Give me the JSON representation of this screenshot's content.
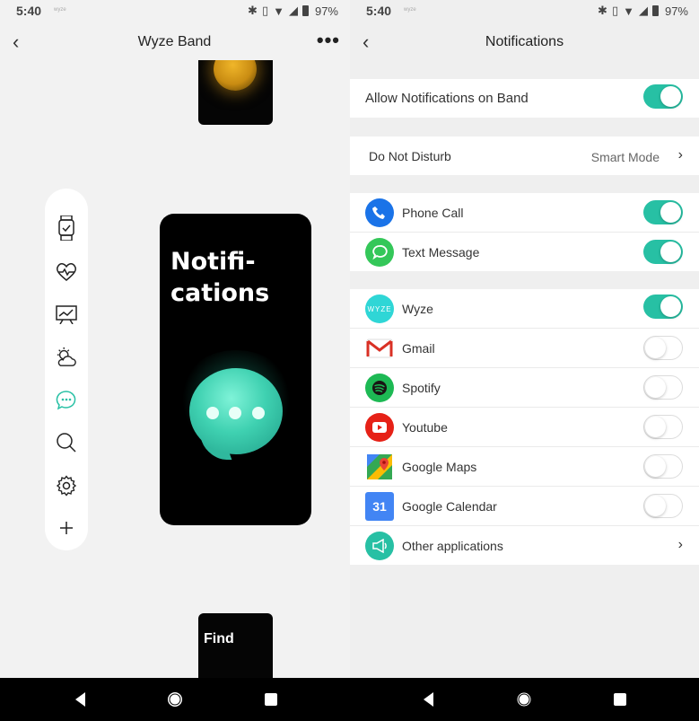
{
  "status": {
    "time": "5:40",
    "tiny_label": "wyze",
    "battery": "97%"
  },
  "left": {
    "title": "Wyze Band",
    "main_card_text": "Notifi-\ncations",
    "bottom_card_text": "Find"
  },
  "right": {
    "title": "Notifications",
    "allow_label": "Allow Notifications on Band",
    "dnd_label": "Do Not Disturb",
    "dnd_value": "Smart Mode",
    "apps": [
      {
        "name": "Phone Call",
        "enabled": true,
        "icon": "phone-icon",
        "color": "#1a73e8"
      },
      {
        "name": "Text Message",
        "enabled": true,
        "icon": "message-icon",
        "color": "#34c759"
      },
      {
        "name": "Wyze",
        "enabled": true,
        "icon": "wyze-logo",
        "color": "#2fd6d6",
        "icon_text": "WYZE"
      },
      {
        "name": "Gmail",
        "enabled": false,
        "icon": "gmail-icon",
        "color": "#d93025"
      },
      {
        "name": "Spotify",
        "enabled": false,
        "icon": "spotify-icon",
        "color": "#1db954"
      },
      {
        "name": "Youtube",
        "enabled": false,
        "icon": "youtube-icon",
        "color": "#e62117"
      },
      {
        "name": "Google Maps",
        "enabled": false,
        "icon": "maps-icon",
        "color": "#34a853"
      },
      {
        "name": "Google Calendar",
        "enabled": false,
        "icon": "calendar-icon",
        "color": "#4285f4",
        "icon_text": "31"
      }
    ],
    "other_label": "Other applications"
  },
  "colors": {
    "accent": "#27c0a4"
  }
}
